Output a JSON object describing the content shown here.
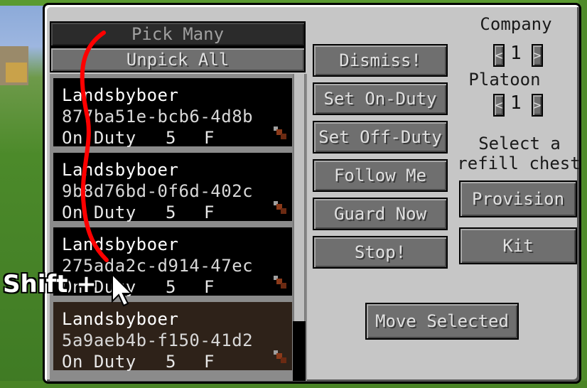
{
  "colors": {
    "panel": "#c6c6c6",
    "button": "#6f6f6f",
    "card": "#000000",
    "stroke": "#ff0000"
  },
  "list": {
    "pick_many_label": "Pick Many",
    "unpick_all_label": "Unpick All",
    "entries": [
      {
        "name": "Landsbyboer",
        "uuid": "877ba51e-bcb6-4d8b",
        "status": "On Duty",
        "level": "5",
        "flag": "F",
        "icon": "sword-icon"
      },
      {
        "name": "Landsbyboer",
        "uuid": "9b8d76bd-0f6d-402c",
        "status": "On Duty",
        "level": "5",
        "flag": "F",
        "icon": "sword-icon"
      },
      {
        "name": "Landsbyboer",
        "uuid": "275ada2c-d914-47ec",
        "status": "On Duty",
        "level": "5",
        "flag": "F",
        "icon": "sword-icon"
      },
      {
        "name": "Landsbyboer",
        "uuid": "5a9aeb4b-f150-41d2",
        "status": "On Duty",
        "level": "5",
        "flag": "F",
        "icon": "sword-icon"
      }
    ]
  },
  "actions": {
    "dismiss": "Dismiss!",
    "set_on_duty": "Set On-Duty",
    "set_off_duty": "Set Off-Duty",
    "follow_me": "Follow Me",
    "guard_now": "Guard Now",
    "stop": "Stop!",
    "move_selected": "Move Selected"
  },
  "right": {
    "company_label": "Company",
    "company_value": "1",
    "platoon_label": "Platoon",
    "platoon_value": "1",
    "prev_arrow": "<",
    "next_arrow": ">",
    "select_line1": "Select a",
    "select_line2": "refill chest",
    "provision": "Provision",
    "kit": "Kit"
  },
  "overlay": {
    "hint": "Shift +"
  }
}
